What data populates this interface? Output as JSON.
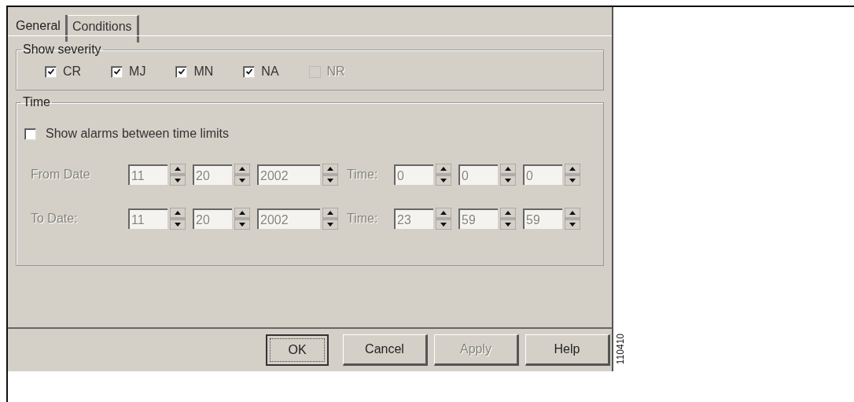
{
  "tabs": [
    {
      "label": "General",
      "selected": true
    },
    {
      "label": "Conditions",
      "selected": false
    }
  ],
  "severity": {
    "title": "Show severity",
    "items": [
      {
        "label": "CR",
        "checked": true,
        "disabled": false
      },
      {
        "label": "MJ",
        "checked": true,
        "disabled": false
      },
      {
        "label": "MN",
        "checked": true,
        "disabled": false
      },
      {
        "label": "NA",
        "checked": true,
        "disabled": false
      },
      {
        "label": "NR",
        "checked": false,
        "disabled": true
      }
    ]
  },
  "time": {
    "title": "Time",
    "limits": {
      "label": "Show alarms between time limits",
      "checked": false
    },
    "rows": [
      {
        "label": "From Date",
        "date": [
          "11",
          "20",
          "2002"
        ],
        "time_label": "Time:",
        "time": [
          "0",
          "0",
          "0"
        ]
      },
      {
        "label": "To Date:",
        "date": [
          "11",
          "20",
          "2002"
        ],
        "time_label": "Time:",
        "time": [
          "23",
          "59",
          "59"
        ]
      }
    ]
  },
  "buttons": [
    {
      "label": "OK",
      "default": true,
      "disabled": false
    },
    {
      "label": "Cancel",
      "default": false,
      "disabled": false
    },
    {
      "label": "Apply",
      "default": false,
      "disabled": true
    },
    {
      "label": "Help",
      "default": false,
      "disabled": false
    }
  ],
  "figure_id": "110410"
}
